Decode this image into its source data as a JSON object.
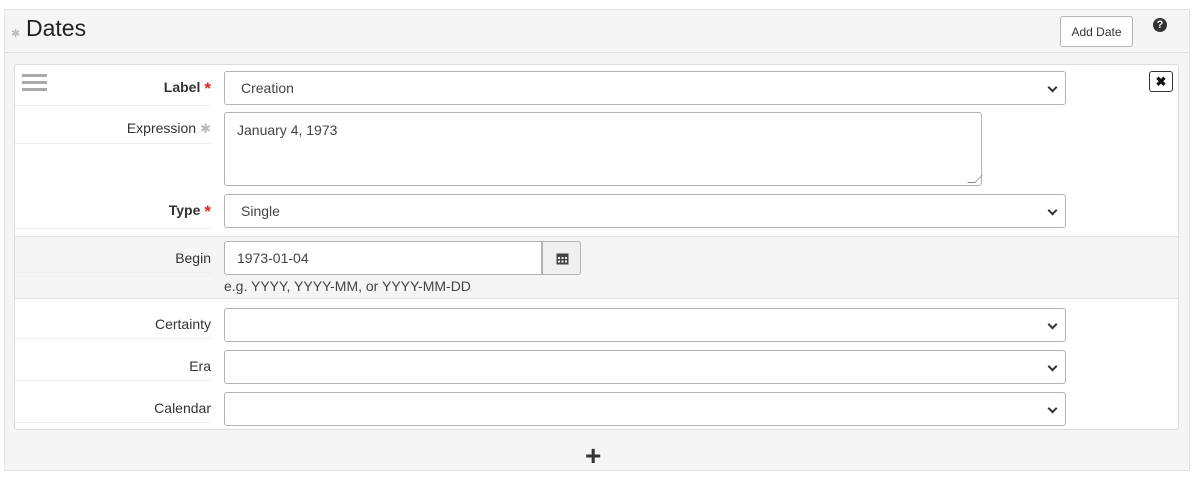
{
  "section": {
    "title": "Dates",
    "add_button_label": "Add Date",
    "help_glyph": "?"
  },
  "record": {
    "remove_glyph": "✖",
    "label": {
      "label": "Label",
      "value": "Creation"
    },
    "expression": {
      "label": "Expression",
      "value": "January 4, 1973"
    },
    "type": {
      "label": "Type",
      "value": "Single"
    },
    "begin": {
      "label": "Begin",
      "value": "1973-01-04",
      "hint": "e.g. YYYY, YYYY-MM, or YYYY-MM-DD"
    },
    "certainty": {
      "label": "Certainty",
      "value": ""
    },
    "era": {
      "label": "Era",
      "value": ""
    },
    "calendar": {
      "label": "Calendar",
      "value": ""
    }
  },
  "footer": {
    "add_glyph": "+"
  },
  "icons": {
    "drag": "drag-handle-icon",
    "remove": "close-icon",
    "help": "question-circle-icon",
    "calendar": "calendar-icon",
    "add": "plus-icon",
    "required": "asterisk-icon"
  },
  "colors": {
    "required": "#e0261f",
    "panel_bg": "#f5f5f5"
  }
}
